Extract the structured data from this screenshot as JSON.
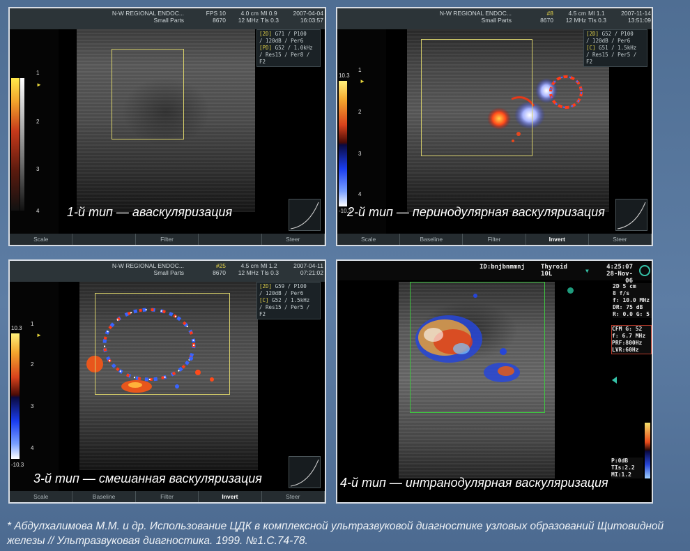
{
  "panels": [
    {
      "header_left": [
        "N-W REGIONAL ENDOC...",
        "Small Parts"
      ],
      "header_id": [
        "FPS 10",
        "8670"
      ],
      "header_depth": [
        "4.0 cm",
        "12 MHz"
      ],
      "header_mi": [
        "MI  0.9",
        "TIs  0.3"
      ],
      "header_date": [
        "2007-04-04",
        "16:03:57"
      ],
      "info": [
        {
          "tag": "[2D]",
          "text": " G71 / P100"
        },
        {
          "tag": "",
          "text": "/ 120dB / Per6"
        },
        {
          "tag": "[PD]",
          "text": " G52 / 1.0kHz"
        },
        {
          "tag": "",
          "text": "/ Res15 / Per8 / F2"
        }
      ],
      "scale_ticks": [
        "1",
        "2",
        "3",
        "4"
      ],
      "caption": "1-й тип — аваскуляризация",
      "footer": [
        "Scale",
        "",
        "Filter",
        "",
        "Steer"
      ],
      "footer_active": -1
    },
    {
      "header_left": [
        "N-W REGIONAL ENDOC...",
        "Small Parts"
      ],
      "header_id": [
        "#8",
        "8670"
      ],
      "header_depth": [
        "4.5 cm",
        "12 MHz"
      ],
      "header_mi": [
        "MI  1.1",
        "TIs  0.3"
      ],
      "header_date": [
        "2007-11-14",
        "13:51:09"
      ],
      "info": [
        {
          "tag": "[2D]",
          "text": " G52 / P100"
        },
        {
          "tag": "",
          "text": "/ 120dB / Per6"
        },
        {
          "tag": "[C]",
          "text": " G51 / 1.5kHz"
        },
        {
          "tag": "",
          "text": "/ Res15 / Per5 / F2"
        }
      ],
      "scale_top": "10.3",
      "scale_bottom": "-10.3",
      "scale_ticks": [
        "1",
        "2",
        "3",
        "4"
      ],
      "caption": "2-й тип — перинодулярная васкуляризация",
      "footer": [
        "Scale",
        "Baseline",
        "Filter",
        "Invert",
        "Steer"
      ],
      "footer_active": 3
    },
    {
      "header_left": [
        "N-W REGIONAL ENDOC...",
        "Small Parts"
      ],
      "header_id": [
        "#25",
        "8670"
      ],
      "header_depth": [
        "4.5 cm",
        "12 MHz"
      ],
      "header_mi": [
        "MI  1.2",
        "TIs  0.3"
      ],
      "header_date": [
        "2007-04-11",
        "07:21:02"
      ],
      "info": [
        {
          "tag": "[2D]",
          "text": " G59 / P100"
        },
        {
          "tag": "",
          "text": "/ 120dB / Per6"
        },
        {
          "tag": "[C]",
          "text": " G52 / 1.5kHz"
        },
        {
          "tag": "",
          "text": "/ Res15 / Per5 / F2"
        }
      ],
      "scale_top": "10.3",
      "scale_bottom": "-10.3",
      "scale_ticks": [
        "1",
        "2",
        "3",
        "4"
      ],
      "caption": "3-й тип — смешанная васкуляризация",
      "footer": [
        "Scale",
        "Baseline",
        "Filter",
        "Invert",
        "Steer"
      ],
      "footer_active": 3
    },
    {
      "id_text": "ID:bnjbnmmnj",
      "preset": [
        "Thyroid",
        "10L"
      ],
      "time": [
        "4:25:07",
        "28-Nov-06"
      ],
      "info_2d": [
        "2D 5 cm",
        "8 f/s",
        "f: 10.0 MHz",
        "DR: 75 dB",
        "R: 0.0   G: 5"
      ],
      "info_cfm": [
        "CFM G: 52",
        "f: 6.7 MHz",
        "PRF:800Hz",
        "LVR:60Hz"
      ],
      "info_bottom": [
        "P:0dB",
        "TIs:2.2",
        "MI:1.2"
      ],
      "caption": "4-й тип — интранодулярная васкуляризация"
    }
  ],
  "citation": "* Абдулхалимова М.М. и др. Использование ЦДК в комплексной ультразвуковой диагностике узловых образований Щитовидной железы // Ультразвуковая диагностика. 1999. №1.С.74-78."
}
